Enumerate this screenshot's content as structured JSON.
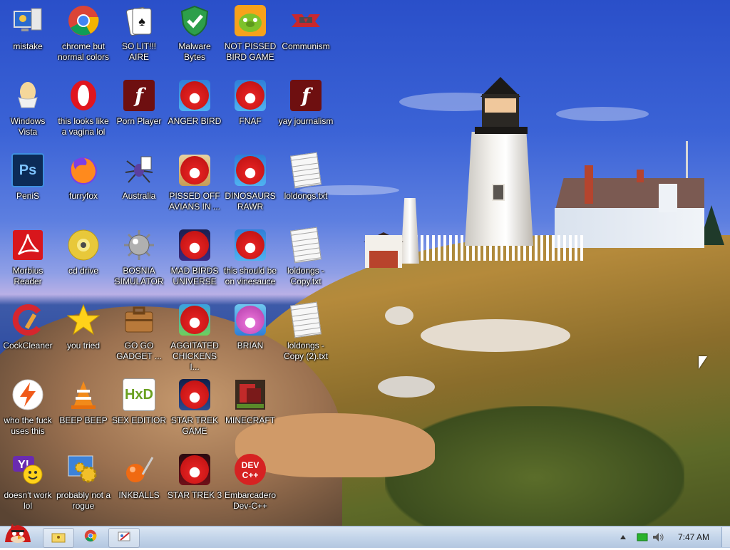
{
  "desktop": {
    "icons": [
      {
        "label": "mistake",
        "icon": "computer-monitor-icon"
      },
      {
        "label": "chrome but normal colors",
        "icon": "chrome-icon"
      },
      {
        "label": "SO LIT!!! AIRE",
        "icon": "solitaire-cards-icon"
      },
      {
        "label": "Malware Bytes",
        "icon": "shield-check-icon"
      },
      {
        "label": "NOT PISSED BIRD GAME",
        "icon": "green-pig-icon"
      },
      {
        "label": "Communism",
        "icon": "red-banner-icon"
      },
      {
        "label": "Windows Vista",
        "icon": "egg-cup-icon"
      },
      {
        "label": "this looks like a vagina lol",
        "icon": "opera-icon"
      },
      {
        "label": "Porn Player",
        "icon": "flash-icon"
      },
      {
        "label": "ANGER BIRD",
        "icon": "angry-bird-icon"
      },
      {
        "label": "FNAF",
        "icon": "angry-bird-icon"
      },
      {
        "label": "yay journalism",
        "icon": "flash-icon"
      },
      {
        "label": "PeniS",
        "icon": "photoshop-icon"
      },
      {
        "label": "furryfox",
        "icon": "firefox-icon"
      },
      {
        "label": "Australia",
        "icon": "spider-solitaire-icon"
      },
      {
        "label": "PISSED OFF AVIANS IN ...",
        "icon": "angry-bird-seasons-icon"
      },
      {
        "label": "DINOSAURS RAWR",
        "icon": "angry-bird-icon"
      },
      {
        "label": "loldongs.txt",
        "icon": "text-document-icon"
      },
      {
        "label": "Morbius Reader",
        "icon": "pdf-reader-icon"
      },
      {
        "label": "cd drive",
        "icon": "cd-disc-icon"
      },
      {
        "label": "BOSNIA SIMULATOR",
        "icon": "spiked-mine-icon"
      },
      {
        "label": "MAD BIRDS UNIVERSE",
        "icon": "angry-bird-space-icon"
      },
      {
        "label": "this should be on vinesauce",
        "icon": "angry-bird-icon"
      },
      {
        "label": "loldongs - Copy.txt",
        "icon": "text-document-icon"
      },
      {
        "label": "CockCleaner",
        "icon": "ccleaner-icon"
      },
      {
        "label": "you tried",
        "icon": "gold-star-icon"
      },
      {
        "label": "GO GO GADGET ...",
        "icon": "briefcase-icon"
      },
      {
        "label": "AGGITATED CHICKENS I...",
        "icon": "angry-bird-rio-icon"
      },
      {
        "label": "BRIAN",
        "icon": "bird-with-hat-icon"
      },
      {
        "label": "loldongs - Copy (2).txt",
        "icon": "text-document-icon"
      },
      {
        "label": "who the fuck uses this",
        "icon": "lightning-icon"
      },
      {
        "label": "BEEP BEEP",
        "icon": "traffic-cone-icon"
      },
      {
        "label": "SEX EDITIOR",
        "icon": "hex-editor-icon"
      },
      {
        "label": "STAR TREK GAME",
        "icon": "angry-bird-star-wars-icon"
      },
      {
        "label": "MINECRAFT",
        "icon": "minecraft-icon"
      },
      {
        "label": "doesn't work lol",
        "icon": "yahoo-messenger-icon"
      },
      {
        "label": "probably not a rogue",
        "icon": "control-panel-gears-icon"
      },
      {
        "label": "INKBALLS",
        "icon": "inkball-icon"
      },
      {
        "label": "STAR TREK 3",
        "icon": "angry-bird-star-wars-2-icon"
      },
      {
        "label": "Embarcadero Dev-C++",
        "icon": "devcpp-icon"
      }
    ]
  },
  "taskbar": {
    "start_icon": "angry-bird-start-icon",
    "pinned": [
      {
        "icon": "folder-sunflower-icon"
      },
      {
        "icon": "chrome-icon"
      },
      {
        "icon": "paint-icon"
      }
    ],
    "tray_icons": [
      "show-hidden-icons-arrow-icon",
      "network-icon",
      "volume-icon"
    ],
    "clock": "7:47 AM"
  }
}
